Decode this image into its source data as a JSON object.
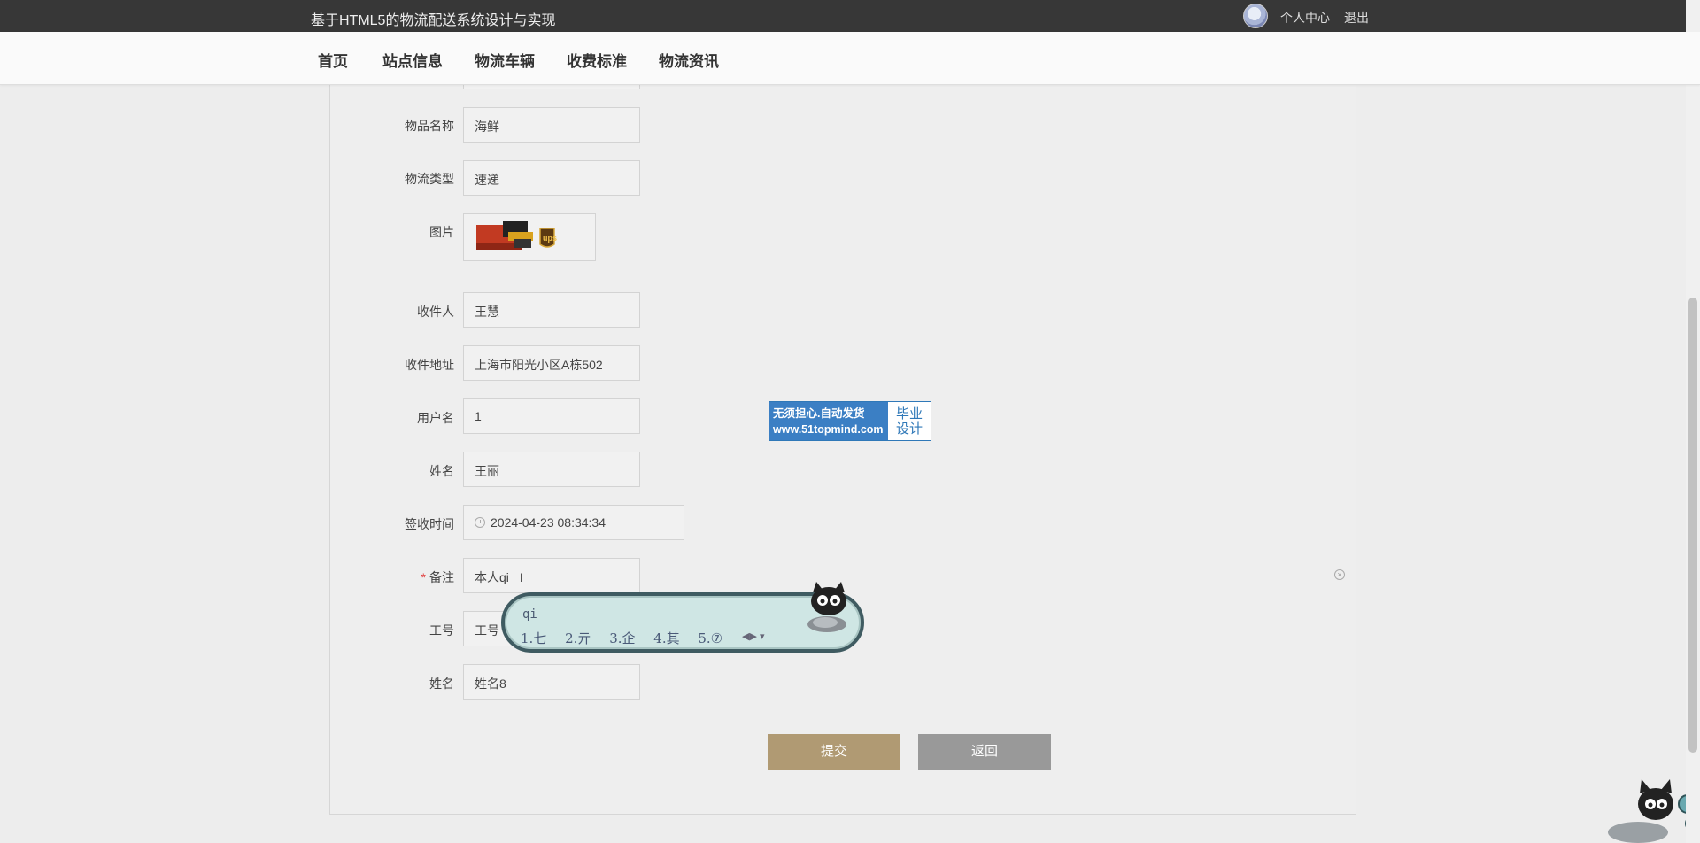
{
  "header": {
    "site_title": "基于HTML5的物流配送系统设计与实现",
    "user_center": "个人中心",
    "logout": "退出"
  },
  "nav": {
    "items": [
      "首页",
      "站点信息",
      "物流车辆",
      "收费标准",
      "物流资讯"
    ]
  },
  "form": {
    "item_name": {
      "label": "物品名称",
      "value": "海鲜"
    },
    "logistics_type": {
      "label": "物流类型",
      "value": "速递"
    },
    "image": {
      "label": "图片"
    },
    "recipient": {
      "label": "收件人",
      "value": "王慧"
    },
    "recipient_address": {
      "label": "收件地址",
      "value": "上海市阳光小区A栋502"
    },
    "username": {
      "label": "用户名",
      "value": "1"
    },
    "name": {
      "label": "姓名",
      "value": "王丽"
    },
    "sign_time": {
      "label": "签收时间",
      "value": "2024-04-23 08:34:34"
    },
    "remark": {
      "label": "备注",
      "required_mark": "*",
      "value": "本人qi"
    },
    "job_number": {
      "label": "工号",
      "value": "工号"
    },
    "name2": {
      "label": "姓名",
      "value": "姓名8"
    }
  },
  "buttons": {
    "submit": "提交",
    "back": "返回"
  },
  "watermark": {
    "line1": "无须担心.自动发货",
    "line2": "www.51topmind.com",
    "right1": "毕业",
    "right2": "设计"
  },
  "ime": {
    "composition": "qi",
    "candidates": [
      "1.七",
      "2.亓",
      "3.企",
      "4.其",
      "5.⑦"
    ]
  }
}
